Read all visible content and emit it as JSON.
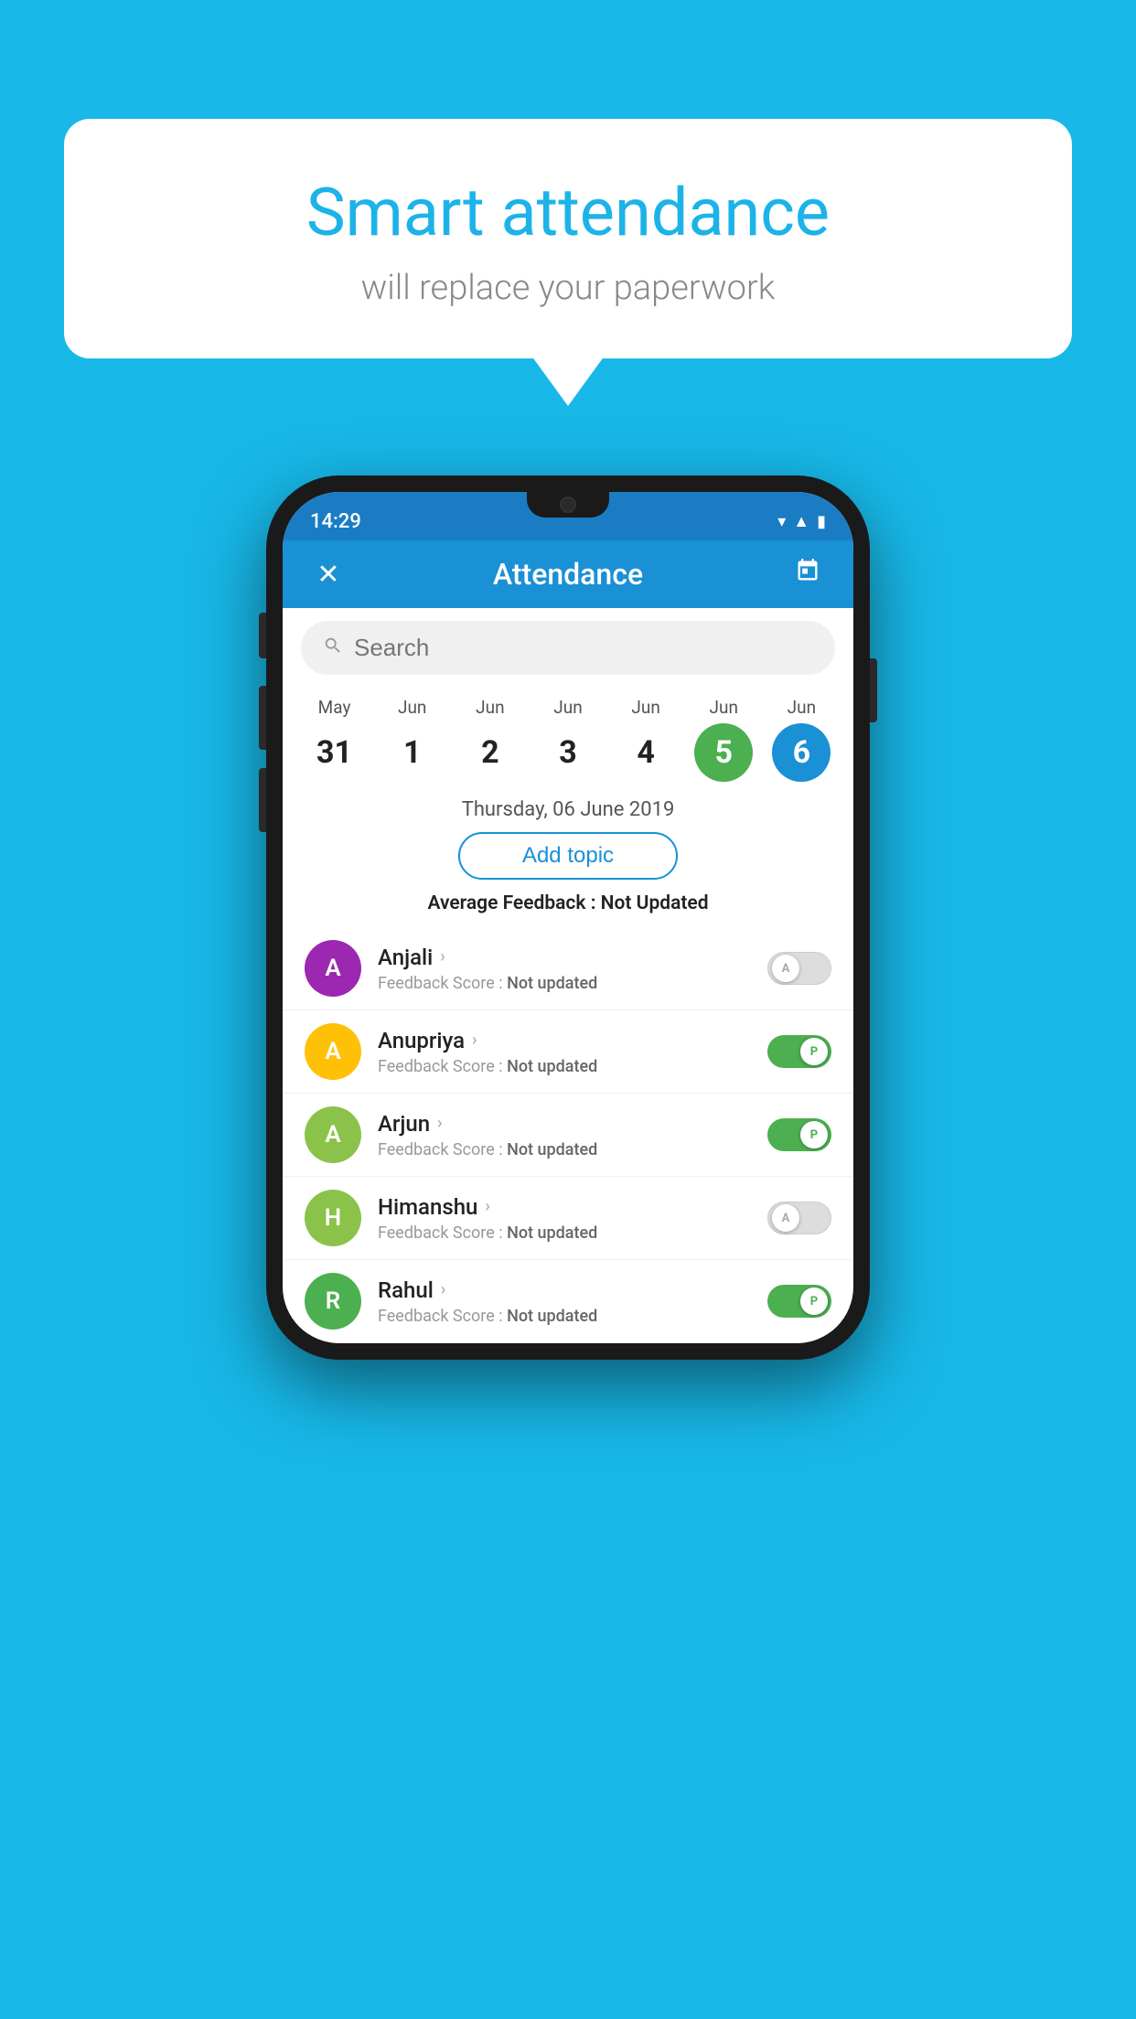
{
  "background_color": "#18b8e8",
  "speech_bubble": {
    "title": "Smart attendance",
    "subtitle": "will replace your paperwork"
  },
  "status_bar": {
    "time": "14:29",
    "icons": [
      "wifi",
      "signal",
      "battery"
    ]
  },
  "app_bar": {
    "title": "Attendance",
    "close_label": "✕",
    "calendar_label": "📅"
  },
  "search": {
    "placeholder": "Search"
  },
  "calendar": {
    "days": [
      {
        "month": "May",
        "num": "31",
        "state": "normal"
      },
      {
        "month": "Jun",
        "num": "1",
        "state": "normal"
      },
      {
        "month": "Jun",
        "num": "2",
        "state": "normal"
      },
      {
        "month": "Jun",
        "num": "3",
        "state": "normal"
      },
      {
        "month": "Jun",
        "num": "4",
        "state": "normal"
      },
      {
        "month": "Jun",
        "num": "5",
        "state": "today"
      },
      {
        "month": "Jun",
        "num": "6",
        "state": "selected"
      }
    ],
    "selected_date": "Thursday, 06 June 2019"
  },
  "add_topic_label": "Add topic",
  "average_feedback": {
    "label": "Average Feedback : ",
    "value": "Not Updated"
  },
  "students": [
    {
      "name": "Anjali",
      "avatar_letter": "A",
      "avatar_color": "#9c27b0",
      "feedback_label": "Feedback Score : ",
      "feedback_value": "Not updated",
      "toggle_state": "off",
      "toggle_label": "A"
    },
    {
      "name": "Anupriya",
      "avatar_letter": "A",
      "avatar_color": "#ffc107",
      "feedback_label": "Feedback Score : ",
      "feedback_value": "Not updated",
      "toggle_state": "on",
      "toggle_label": "P"
    },
    {
      "name": "Arjun",
      "avatar_letter": "A",
      "avatar_color": "#8bc34a",
      "feedback_label": "Feedback Score : ",
      "feedback_value": "Not updated",
      "toggle_state": "on",
      "toggle_label": "P"
    },
    {
      "name": "Himanshu",
      "avatar_letter": "H",
      "avatar_color": "#8bc34a",
      "feedback_label": "Feedback Score : ",
      "feedback_value": "Not updated",
      "toggle_state": "off",
      "toggle_label": "A"
    },
    {
      "name": "Rahul",
      "avatar_letter": "R",
      "avatar_color": "#4caf50",
      "feedback_label": "Feedback Score : ",
      "feedback_value": "Not updated",
      "toggle_state": "on",
      "toggle_label": "P"
    }
  ]
}
